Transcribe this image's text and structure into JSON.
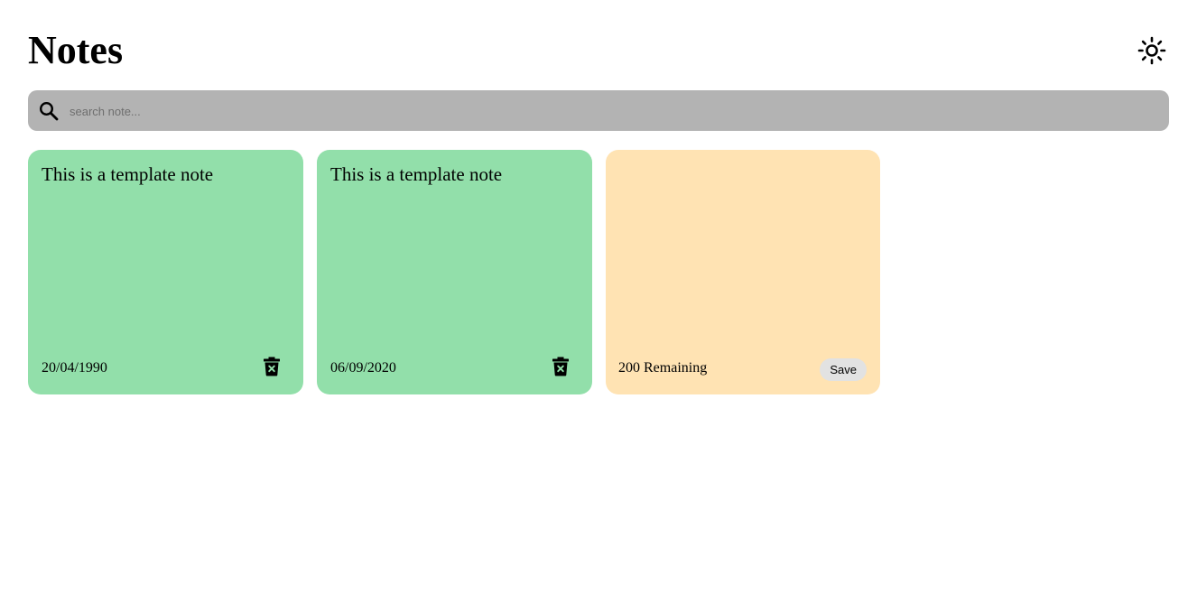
{
  "header": {
    "title": "Notes",
    "theme_toggle_icon": "sun-icon"
  },
  "search": {
    "icon": "search-icon",
    "value": "",
    "placeholder": "search note..."
  },
  "notes": [
    {
      "text": "This is a template note",
      "date": "20/04/1990",
      "color": "#92dfaa",
      "delete_icon": "trash-icon"
    },
    {
      "text": "This is a template note",
      "date": "06/09/2020",
      "color": "#92dfaa",
      "delete_icon": "trash-icon"
    }
  ],
  "new_note": {
    "value": "",
    "remaining_label": "200 Remaining",
    "save_label": "Save",
    "color": "#ffe3b3"
  }
}
